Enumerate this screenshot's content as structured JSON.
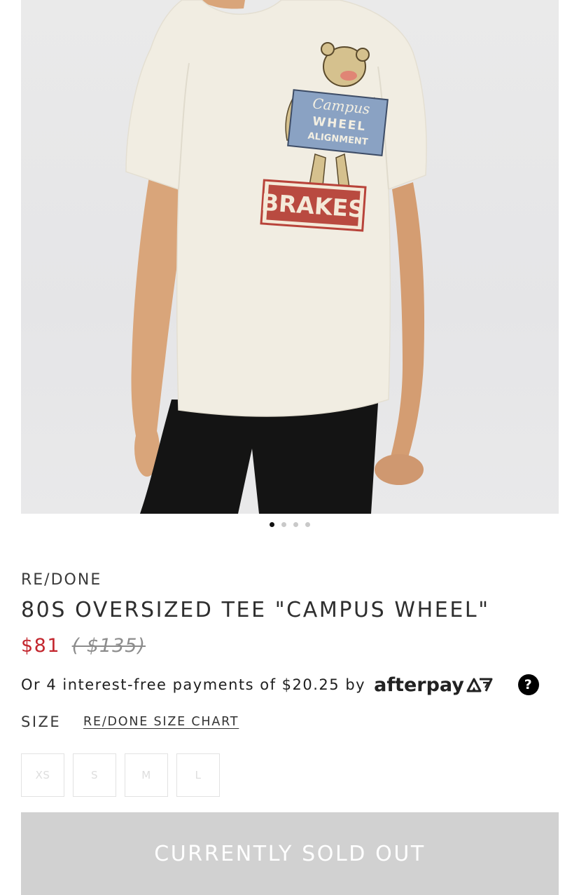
{
  "image": {
    "subject": "product-photo",
    "graphic_text": {
      "line1": "Campus",
      "line2": "WHEEL",
      "line3": "ALIGNMENT",
      "sign": "BRAKES"
    }
  },
  "gallery": {
    "dots": [
      {
        "active": true
      },
      {
        "active": false
      },
      {
        "active": false
      },
      {
        "active": false
      }
    ]
  },
  "product": {
    "brand": "RE/DONE",
    "title": "80S OVERSIZED TEE \"CAMPUS WHEEL\"",
    "price_now": "$81",
    "price_was": "( $135)"
  },
  "afterpay": {
    "text": "Or 4 interest-free payments of $20.25 by",
    "logo_text": "afterpay",
    "help_glyph": "?"
  },
  "size": {
    "label": "SIZE",
    "chart_link": "RE/DONE SIZE CHART",
    "options": [
      "XS",
      "S",
      "M",
      "L"
    ]
  },
  "cta": {
    "label": "CURRENTLY SOLD OUT"
  },
  "colors": {
    "sale_price": "#c3262e",
    "sold_out_bg": "#d1d1d1",
    "afterpay_mint": "#b2fce4"
  }
}
